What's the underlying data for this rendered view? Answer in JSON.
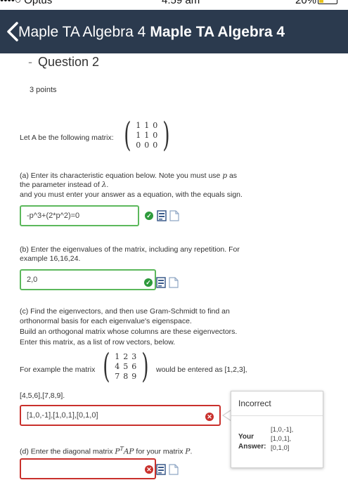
{
  "status_bar": {
    "carrier": "••••○ Optus ",
    "time": "4:59 am",
    "battery": "20%"
  },
  "nav": {
    "title_light": "Maple TA Algebra 4",
    "title_bold": "Maple TA Algebra 4"
  },
  "question": {
    "dash": "-",
    "title": "Question 2",
    "points": "3 points",
    "intro": "Let A be the following matrix:",
    "matrix_a": [
      "1",
      "1",
      "0",
      "1",
      "1",
      "0",
      "0",
      "0",
      "0"
    ],
    "part_a": {
      "line1_pre": "(a) Enter its characteristic equation below. Note you must use ",
      "var": "p",
      "line1_post": " as",
      "line2_pre": "the parameter instead of ",
      "lambda": "λ",
      "line2_post": ".",
      "line3": "and you must enter your answer as a equation, with the equals sign.",
      "answer": "-p^3+(2*p^2)=0"
    },
    "part_b": {
      "line1": "(b) Enter the eigenvalues of the matrix, including any repetition. For",
      "line2": "example 16,16,24.",
      "answer": "2,0"
    },
    "part_c": {
      "line1": "(c) Find the eigenvectors, and then use Gram-Schmidt to find an",
      "line2": "orthonormal basis for each eigenvalue's eigenspace.",
      "line3": "Build an orthogonal matrix whose columns are these eigenvectors.",
      "line4": "Enter this matrix, as a list of row vectors, below.",
      "example_pre": "For example the matrix",
      "example_matrix": [
        "1",
        "2",
        "3",
        "4",
        "5",
        "6",
        "7",
        "8",
        "9"
      ],
      "example_post": "would be entered as [1,2,3],",
      "example_cont": "[4,5,6],[7,8,9].",
      "answer": "[1,0,-1],[1,0,1],[0,1,0]"
    },
    "part_d": {
      "pre": "(d) Enter the diagonal matrix ",
      "formula_p": "P",
      "formula_sup": "T",
      "formula_ap": "AP",
      "mid": " for your matrix ",
      "mat": "P",
      "post": ".",
      "answer": ""
    }
  },
  "feedback": {
    "title": "Incorrect",
    "label_line1": "Your",
    "label_line2": "Answer:",
    "values": [
      "[1,0,-1],",
      "[1,0,1],",
      "[0,1,0]"
    ]
  },
  "colors": {
    "nav_bg": "#2b3a4e",
    "correct": "#5cb85c",
    "incorrect": "#c9302c"
  }
}
